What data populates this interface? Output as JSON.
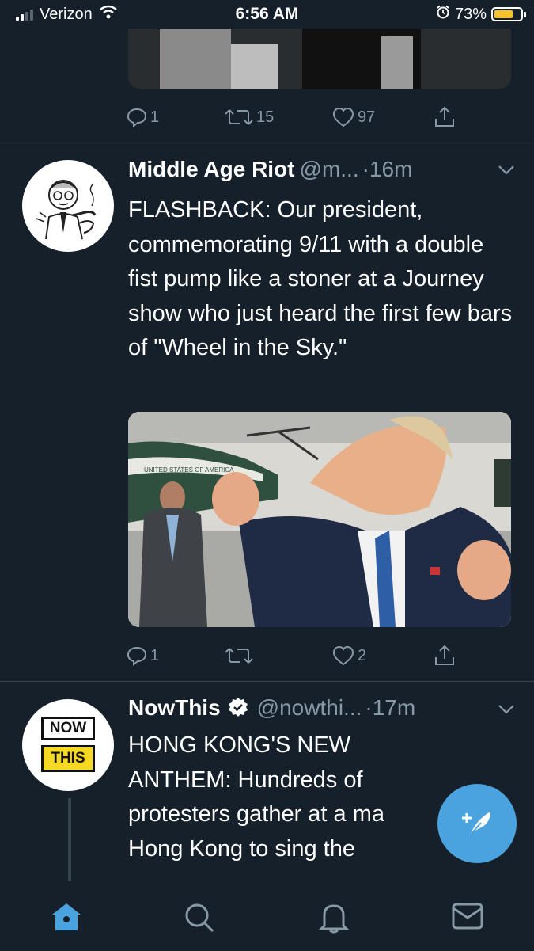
{
  "status_bar": {
    "carrier": "Verizon",
    "time": "6:56 AM",
    "battery": "73%",
    "battery_level": 0.73
  },
  "tweets": [
    {
      "partial": true,
      "stats": {
        "replies": "1",
        "retweets": "15",
        "likes": "97"
      }
    },
    {
      "name": "Middle Age Riot",
      "handle": "@m...",
      "time": "·16m",
      "text": "FLASHBACK: Our president, commemorating 9/11 with a double fist pump like a stoner at a Journey show who just heard the first few bars of \"Wheel in the Sky.\"",
      "photo_caption": "UNITED STATES OF AMERICA",
      "stats": {
        "replies": "1",
        "retweets": "",
        "likes": "2"
      }
    },
    {
      "name": "NowThis",
      "handle": "@nowthi...",
      "time": "·17m",
      "verified": true,
      "avatar_text": [
        "NOW",
        "THIS"
      ],
      "text": "HONG KONG'S NEW ANTHEM: Hundreds of protesters gather at a ma Hong Kong to sing the"
    }
  ],
  "tab_bar": {
    "items": [
      "home-icon",
      "search-icon",
      "notifications-icon",
      "messages-icon"
    ],
    "active": "home-icon"
  },
  "colors": {
    "background": "#15202b",
    "accent": "#4aa3df",
    "secondary_text": "#8899a6",
    "divider": "#38444d"
  }
}
